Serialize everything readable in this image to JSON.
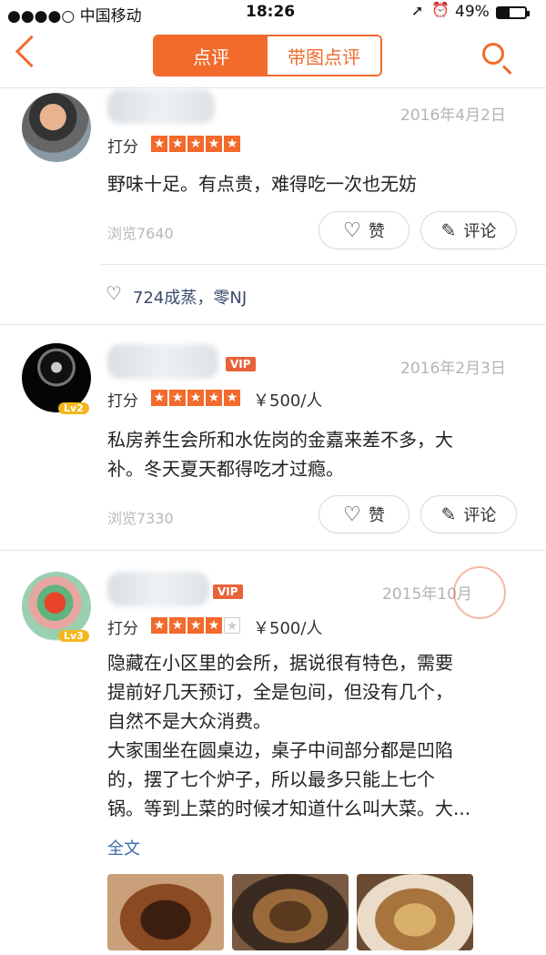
{
  "status_bar": {
    "carrier": "●●●●○ 中国移动",
    "time": "18:26",
    "right_status": "49%"
  },
  "nav": {
    "tabs": [
      "点评",
      "带图点评"
    ]
  },
  "reviews": [
    {
      "date": "2016年4月2日",
      "rating_label": "打分",
      "stars": 5,
      "text": "野味十足。有点贵，难得吃一次也无妨",
      "views": "浏览7640",
      "like_label": "赞",
      "comment_label": "评论",
      "likers": "724成蒸，零NJ"
    },
    {
      "vip": "VIP",
      "level": "Lv2",
      "date": "2016年2月3日",
      "rating_label": "打分",
      "stars": 5,
      "price": "￥500/人",
      "text_lines": [
        "私房养生会所和水佐岗的金嘉来差不多，大",
        "补。冬天夏天都得吃才过瘾。"
      ],
      "views": "浏览7330",
      "like_label": "赞",
      "comment_label": "评论"
    },
    {
      "vip": "VIP",
      "level": "Lv3",
      "date": "2015年10月",
      "rating_label": "打分",
      "stars": 4,
      "price": "￥500/人",
      "text_lines": [
        "隐藏在小区里的会所，据说很有特色，需要",
        "提前好几天预订，全是包间，但没有几个，",
        "自然不是大众消费。",
        "大家围坐在圆桌边，桌子中间部分都是凹陷",
        "的，摆了七个炉子，所以最多只能上七个",
        "锅。等到上菜的时候才知道什么叫大菜。大..."
      ],
      "full_text_link": "全文"
    }
  ]
}
